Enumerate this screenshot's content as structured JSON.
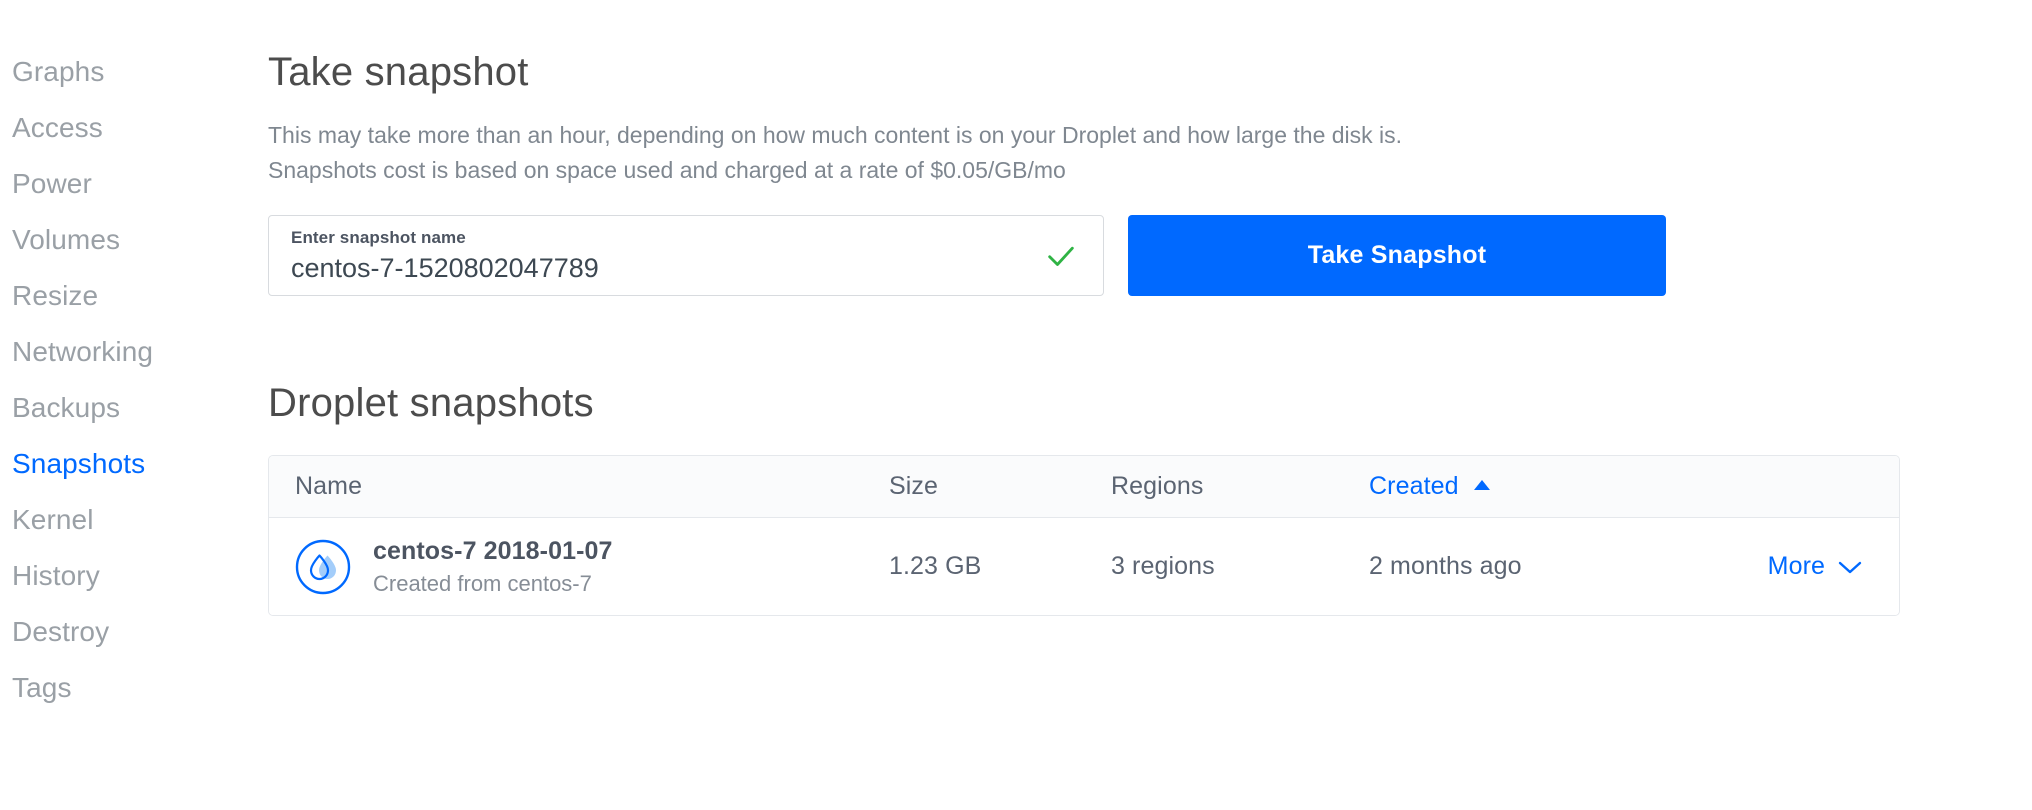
{
  "sidebar": {
    "items": [
      {
        "label": "Graphs",
        "active": false
      },
      {
        "label": "Access",
        "active": false
      },
      {
        "label": "Power",
        "active": false
      },
      {
        "label": "Volumes",
        "active": false
      },
      {
        "label": "Resize",
        "active": false
      },
      {
        "label": "Networking",
        "active": false
      },
      {
        "label": "Backups",
        "active": false
      },
      {
        "label": "Snapshots",
        "active": true
      },
      {
        "label": "Kernel",
        "active": false
      },
      {
        "label": "History",
        "active": false
      },
      {
        "label": "Destroy",
        "active": false
      },
      {
        "label": "Tags",
        "active": false
      }
    ]
  },
  "take_snapshot": {
    "title": "Take snapshot",
    "description_line1": "This may take more than an hour, depending on how much content is on your Droplet and how large the disk is.",
    "description_line2": "Snapshots cost is based on space used and charged at a rate of $0.05/GB/mo",
    "field_label": "Enter snapshot name",
    "field_value": "centos-7-1520802047789",
    "field_placeholder": "Enter snapshot name",
    "valid_icon": "check-icon",
    "button_label": "Take Snapshot"
  },
  "snapshots_section": {
    "title": "Droplet snapshots",
    "columns": [
      {
        "label": "Name",
        "sorted": false,
        "sort_dir": ""
      },
      {
        "label": "Size",
        "sorted": false,
        "sort_dir": ""
      },
      {
        "label": "Regions",
        "sorted": false,
        "sort_dir": ""
      },
      {
        "label": "Created",
        "sorted": true,
        "sort_dir": "asc"
      }
    ],
    "rows": [
      {
        "icon": "droplet-icon",
        "name": "centos-7 2018-01-07",
        "subtitle": "Created from centos-7",
        "size": "1.23 GB",
        "regions": "3 regions",
        "created": "2 months ago",
        "more_label": "More"
      }
    ]
  },
  "colors": {
    "accent_blue": "#0069ff",
    "valid_green": "#2fb344",
    "muted_text": "#9aa0a6",
    "heading": "#4c4c4c"
  }
}
